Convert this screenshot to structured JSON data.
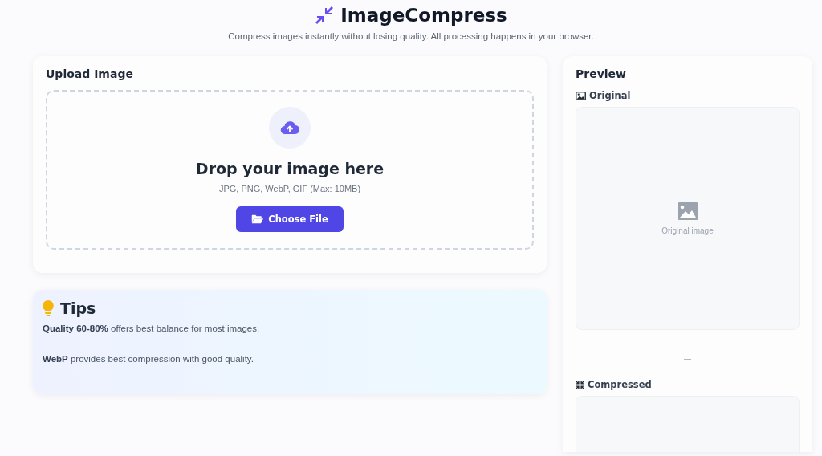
{
  "header": {
    "title": "ImageCompress",
    "subtitle": "Compress images instantly without losing quality. All processing happens in your browser."
  },
  "upload": {
    "title": "Upload Image",
    "drop_title": "Drop your image here",
    "formats": "JPG, PNG, WebP, GIF (Max: 10MB)",
    "button": "Choose File"
  },
  "tips": {
    "title": "Tips",
    "items": [
      "**Quality 60-80%** offers best balance for most images.",
      "**WebP** provides best compression with good quality."
    ]
  },
  "preview": {
    "title": "Preview",
    "original": {
      "label": "Original",
      "placeholder": "Original image"
    },
    "stats": [
      "—",
      "—"
    ],
    "compressed": {
      "label": "Compressed"
    }
  }
}
